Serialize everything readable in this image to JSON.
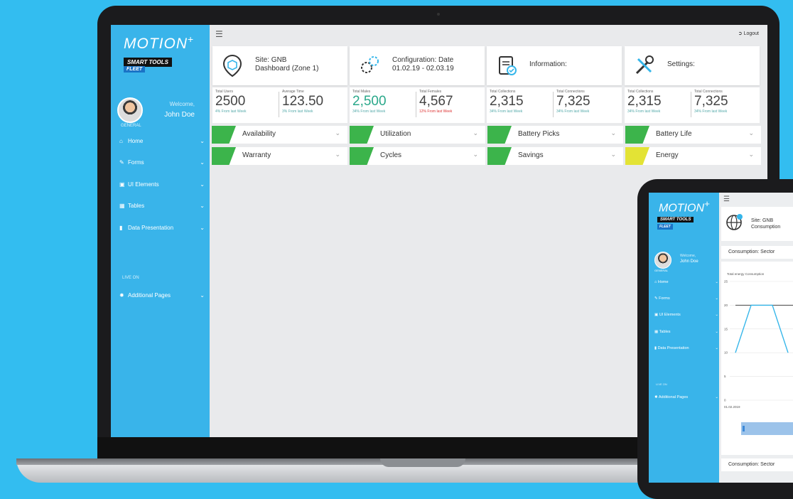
{
  "sidebar": {
    "logo": "MOTION",
    "logo_plus": "+",
    "tag_line1": "SMART TOOLS",
    "tag_line2": "FLEET",
    "welcome": "Welcome,",
    "user_name": "John Doe",
    "role": "GENERAL",
    "nav": [
      {
        "label": "Home",
        "icon": "home-icon"
      },
      {
        "label": "Forms",
        "icon": "edit-icon"
      },
      {
        "label": "UI Elements",
        "icon": "desktop-icon"
      },
      {
        "label": "Tables",
        "icon": "table-icon"
      },
      {
        "label": "Data Presentation",
        "icon": "bar-chart-icon"
      }
    ],
    "live_on": "LIVE ON",
    "additional": "Additional Pages"
  },
  "topbar": {
    "logout": "Logout"
  },
  "cards": [
    {
      "line1": "Site: GNB",
      "line2": "Dashboard (Zone 1)",
      "icon": "location-cube-icon"
    },
    {
      "line1": "Configuration: Date",
      "line2": "01.02.19 - 02.03.19",
      "icon": "gears-icon"
    },
    {
      "line1": "Information:",
      "line2": "",
      "icon": "clipboard-check-icon"
    },
    {
      "line1": "Settings:",
      "line2": "",
      "icon": "tools-icon"
    }
  ],
  "stats": [
    [
      {
        "label": "Total Users",
        "value": "2500",
        "sub": "4% From last Week"
      },
      {
        "label": "Average Time",
        "value": "123.50",
        "sub": "3% From last Week"
      }
    ],
    [
      {
        "label": "Total Males",
        "value": "2,500",
        "sub": "34% From last Week"
      },
      {
        "label": "Total Females",
        "value": "4,567",
        "sub": "12% From last Week"
      }
    ],
    [
      {
        "label": "Total Collections",
        "value": "2,315",
        "sub": "34% From last Week"
      },
      {
        "label": "Total Connections",
        "value": "7,325",
        "sub": "34% From last Week"
      }
    ],
    [
      {
        "label": "Total Collections",
        "value": "2,315",
        "sub": "34% From last Week"
      },
      {
        "label": "Total Connections",
        "value": "7,325",
        "sub": "34% From last Week"
      }
    ]
  ],
  "accordions": [
    [
      {
        "label": "Availability",
        "color": "#3cb44b"
      },
      {
        "label": "Warranty",
        "color": "#3cb44b"
      }
    ],
    [
      {
        "label": "Utilization",
        "color": "#3cb44b"
      },
      {
        "label": "Cycles",
        "color": "#3cb44b"
      }
    ],
    [
      {
        "label": "Battery Picks",
        "color": "#3cb44b"
      },
      {
        "label": "Savings",
        "color": "#3cb44b"
      }
    ],
    [
      {
        "label": "Battery Life",
        "color": "#3cb44b"
      },
      {
        "label": "Energy",
        "color": "#e3e335"
      }
    ]
  ],
  "tablet": {
    "card_line1": "Site: GNB",
    "card_line2": "Consumption",
    "section1": "Consumption: Sector",
    "chart_title": "Total energy Consumption",
    "section2": "Consumption: Sector",
    "xlabel_first": "01.02.2019",
    "chart_data": {
      "type": "line",
      "title": "Total energy Consumption",
      "ylim": [
        0,
        25
      ],
      "yticks": [
        0,
        5,
        10,
        15,
        20,
        25
      ],
      "x": [
        "01.02.2019"
      ],
      "series": [
        {
          "values": [
            10,
            20,
            20,
            10
          ]
        }
      ]
    }
  }
}
